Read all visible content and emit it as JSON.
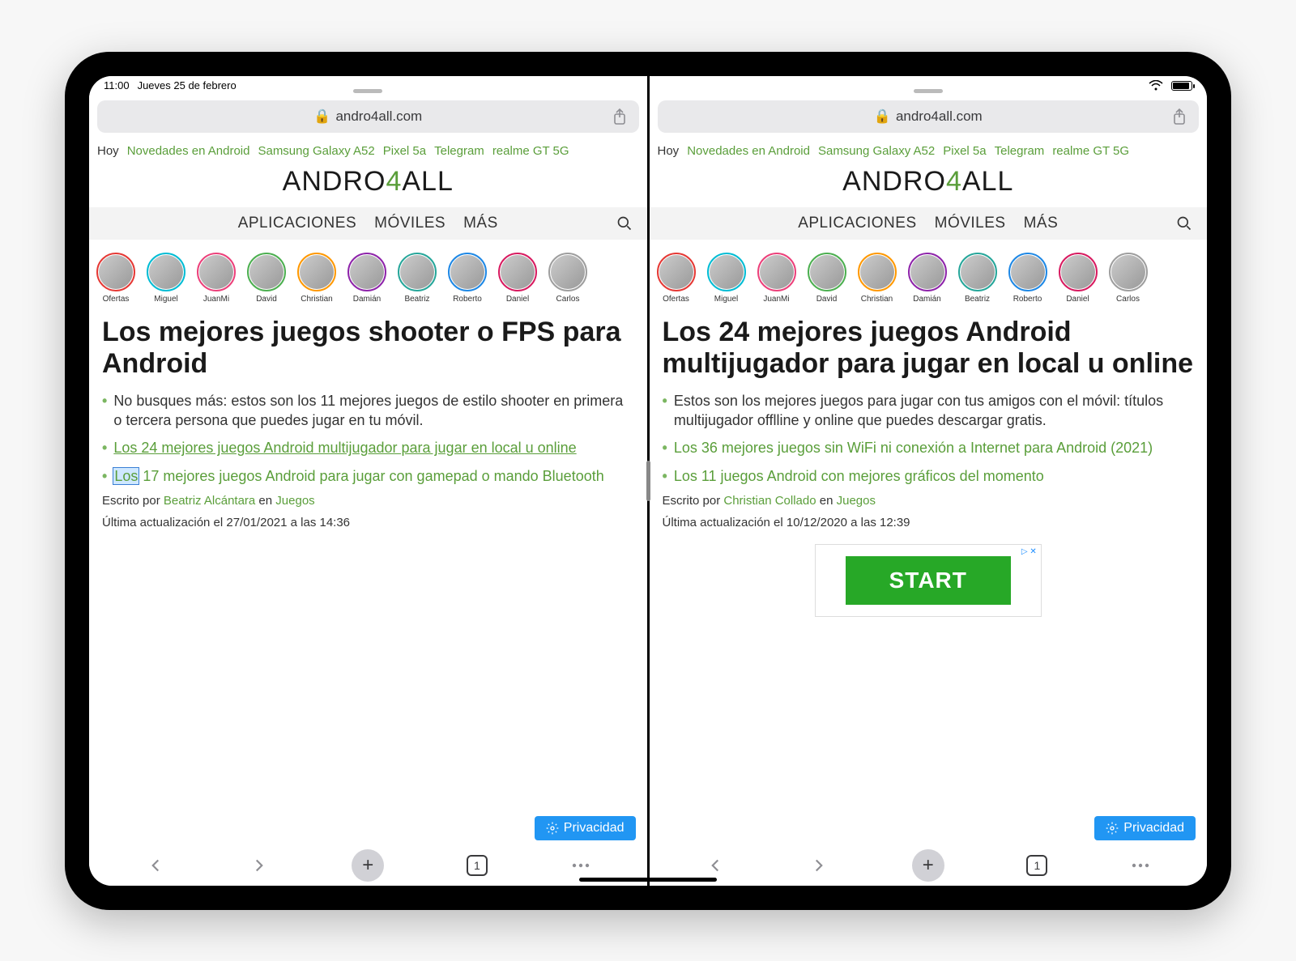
{
  "status": {
    "time": "11:00",
    "date": "Jueves 25 de febrero"
  },
  "browser": {
    "domain": "andro4all.com",
    "tab_count": "1"
  },
  "trending": {
    "label": "Hoy",
    "items": [
      "Novedades en Android",
      "Samsung Galaxy A52",
      "Pixel 5a",
      "Telegram",
      "realme GT 5G"
    ]
  },
  "brand": {
    "pre": "ANDRO",
    "accent": "4",
    "post": "ALL"
  },
  "nav": {
    "items": [
      "APLICACIONES",
      "MÓVILES",
      "MÁS"
    ]
  },
  "stories": [
    "Ofertas",
    "Miguel",
    "JuanMi",
    "David",
    "Christian",
    "Damián",
    "Beatriz",
    "Roberto",
    "Daniel",
    "Carlos"
  ],
  "story_colors": [
    "#e53935",
    "#00bcd4",
    "#ec407a",
    "#4caf50",
    "#ff9800",
    "#8e24aa",
    "#26a69a",
    "#1e88e5",
    "#d81b60",
    "#9e9e9e"
  ],
  "left": {
    "headline": "Los mejores juegos shooter o FPS para Android",
    "bullets": [
      {
        "type": "plain",
        "text": "No busques más: estos son los 11 mejores juegos de estilo shooter en primera o tercera persona que puedes jugar en tu móvil."
      },
      {
        "type": "link",
        "underline": true,
        "text": "Los 24 mejores juegos Android multijugador para jugar en local u online"
      },
      {
        "type": "link",
        "underline": false,
        "sel": "Los",
        "rest": " 17 mejores juegos Android para jugar con gamepad o mando Bluetooth"
      }
    ],
    "by_pre": "Escrito por ",
    "author": "Beatriz Alcántara",
    "by_mid": " en ",
    "category": "Juegos",
    "updated": "Última actualización el 27/01/2021 a las 14:36"
  },
  "right": {
    "headline": "Los 24 mejores juegos Android multijugador para jugar en local u online",
    "bullets": [
      {
        "type": "plain",
        "text": "Estos son los mejores juegos para jugar con tus amigos con el móvil: títulos multijugador offlline y online que puedes descargar gratis."
      },
      {
        "type": "link",
        "underline": false,
        "text": "Los 36 mejores juegos sin WiFi ni conexión a Internet para Android (2021)"
      },
      {
        "type": "link",
        "underline": false,
        "text": "Los 11 juegos Android con mejores gráficos del momento"
      }
    ],
    "by_pre": "Escrito por ",
    "author": "Christian Collado",
    "by_mid": " en ",
    "category": "Juegos",
    "updated": "Última actualización el 10/12/2020 a las 12:39"
  },
  "ad": {
    "label": "START"
  },
  "privacy": "Privacidad"
}
